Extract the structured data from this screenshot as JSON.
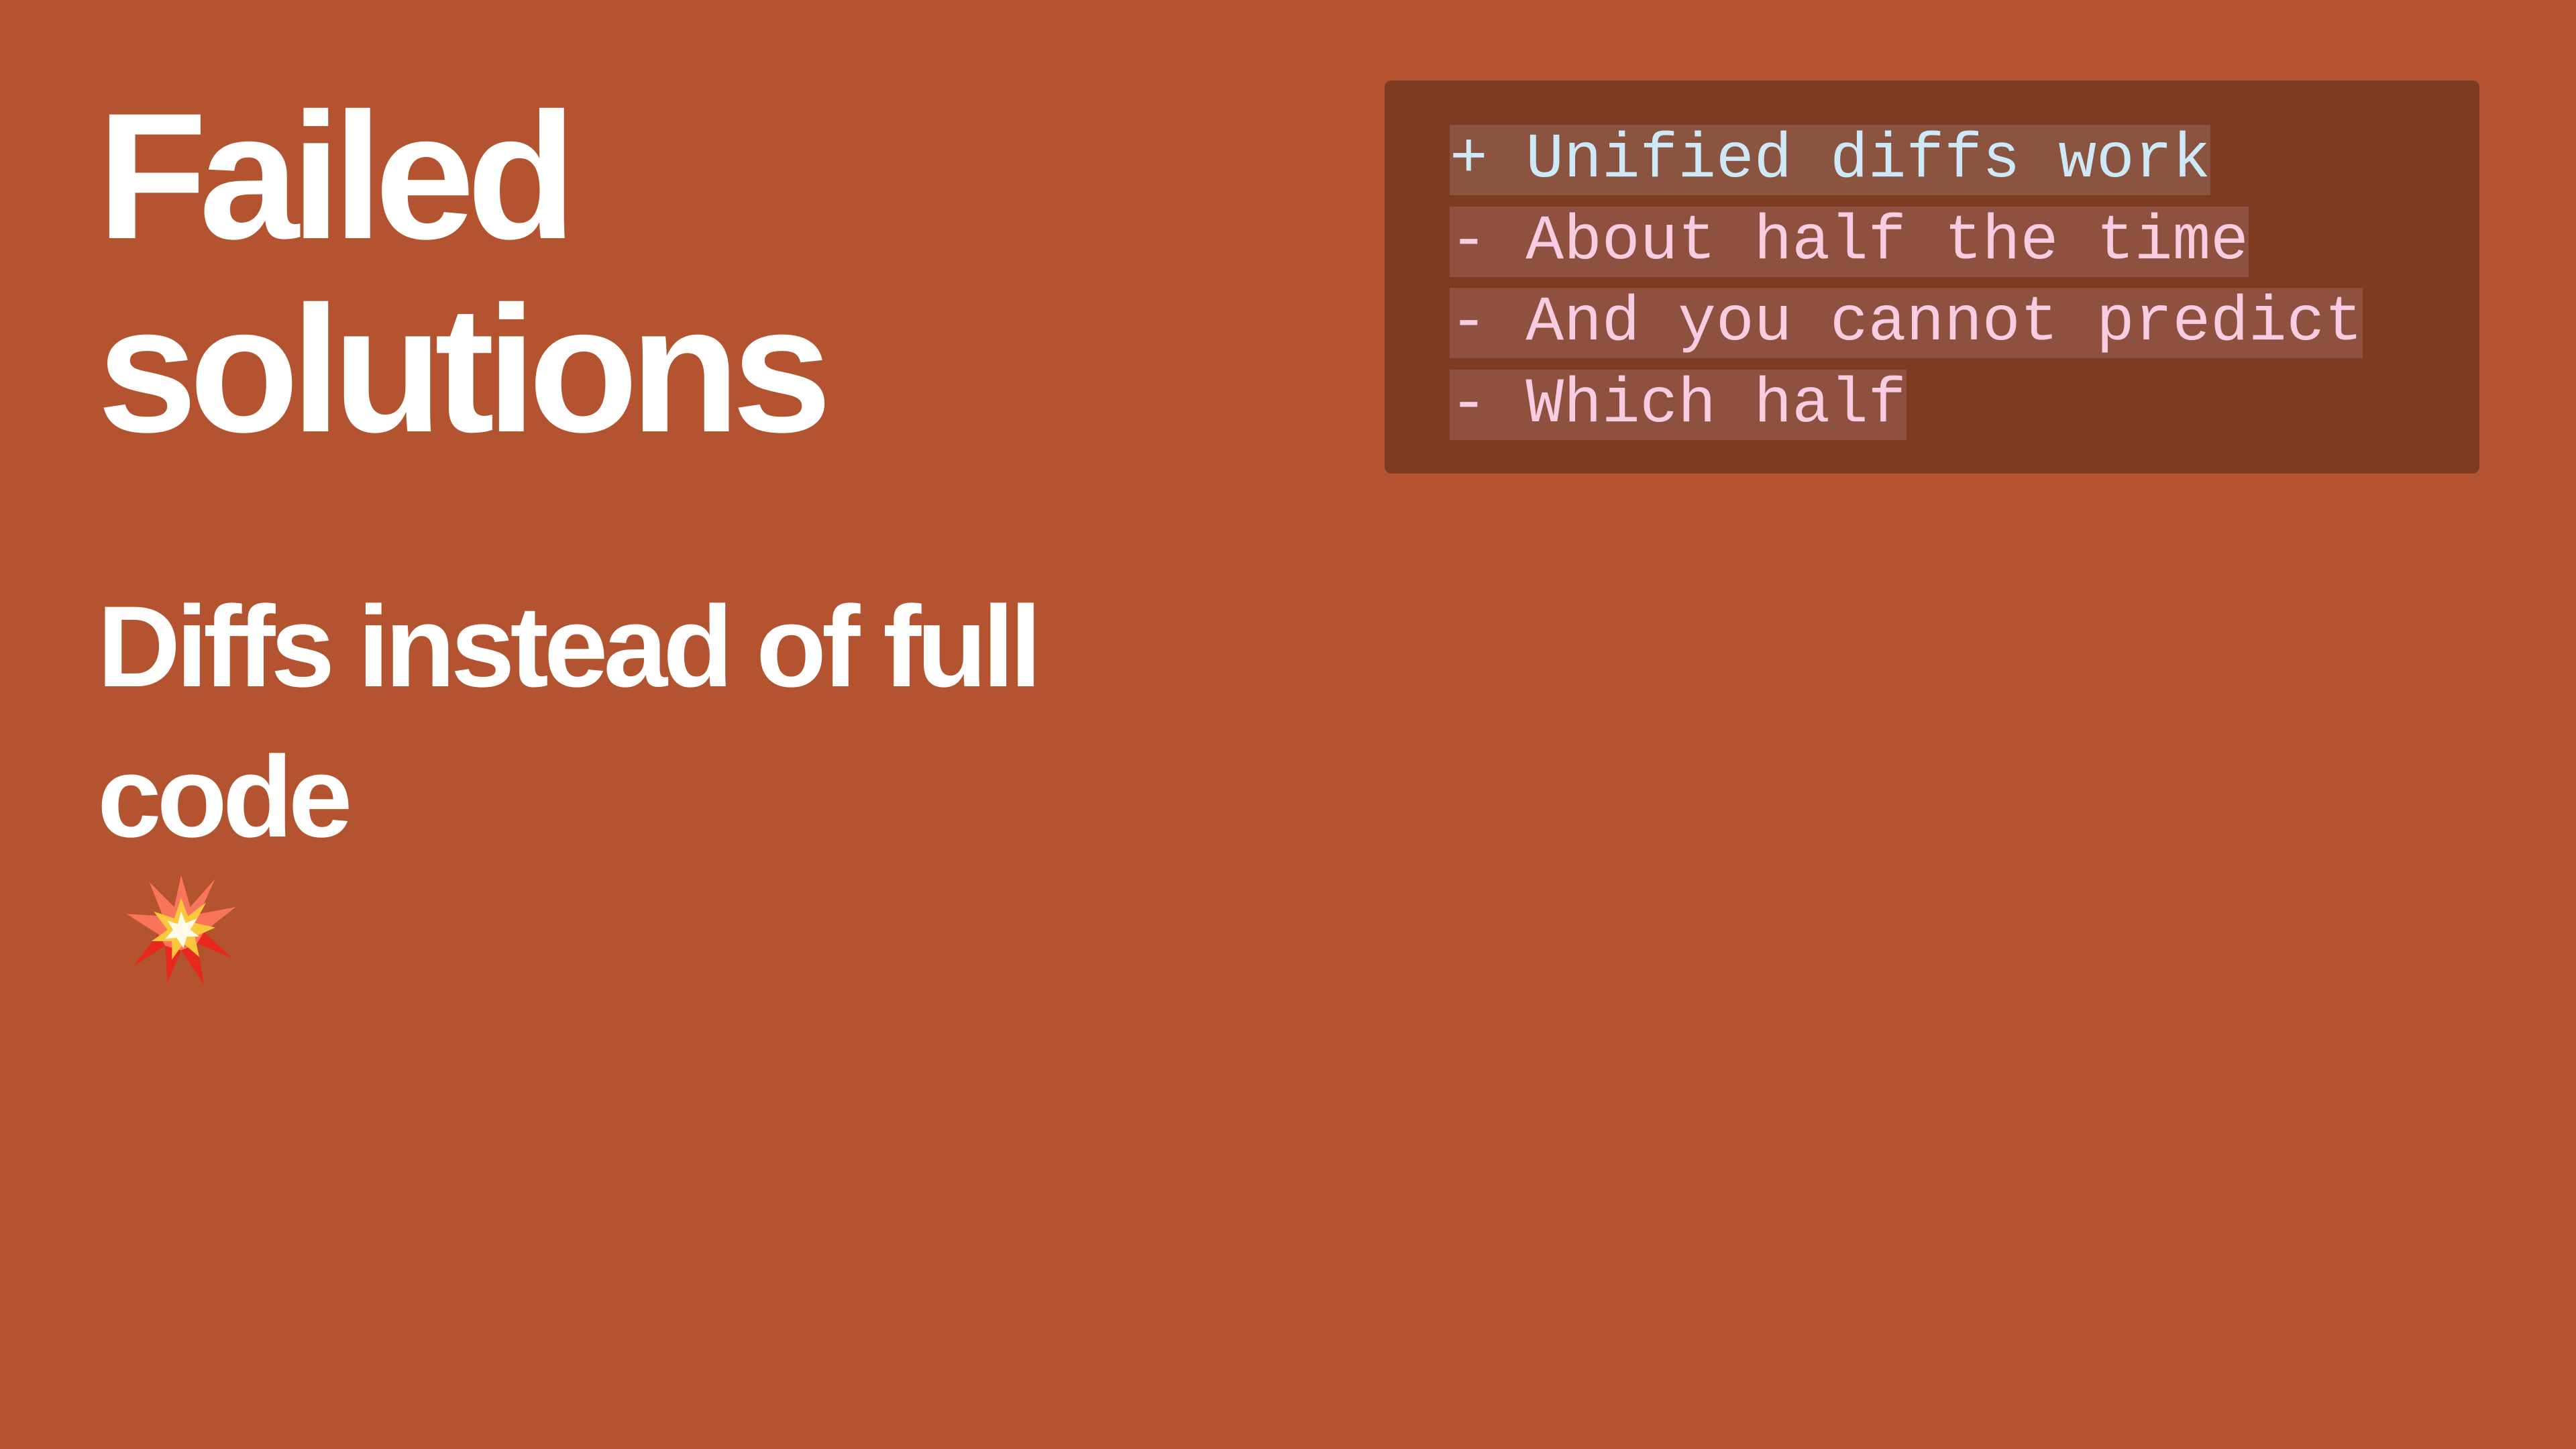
{
  "slide": {
    "title_lines": [
      "Failed",
      "solutions"
    ],
    "subtitle_lines": [
      "Diffs instead of full",
      "code"
    ],
    "subtitle_emoji": "collision-icon",
    "colors": {
      "background": "#B3532F",
      "code_box": "#7D3B21",
      "added_text": "#CDE8F7",
      "removed_text": "#F8CDE2",
      "title_text": "#FFFFFF"
    }
  },
  "code_block": {
    "lines": [
      {
        "kind": "add",
        "text": "+ Unified diffs work"
      },
      {
        "kind": "del",
        "text": "- About half the time"
      },
      {
        "kind": "del",
        "text": "- And you cannot predict"
      },
      {
        "kind": "del",
        "text": "- Which half"
      }
    ]
  }
}
